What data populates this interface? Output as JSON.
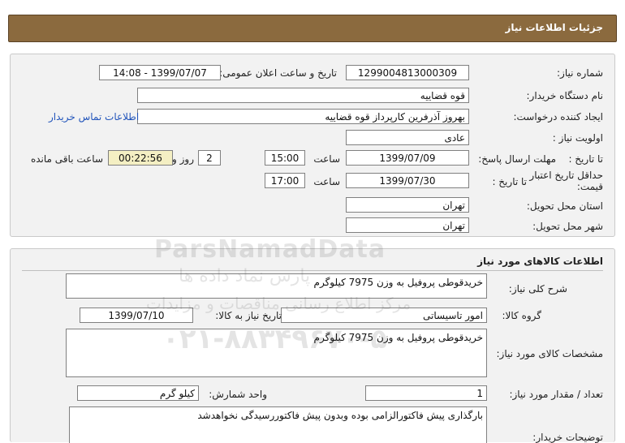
{
  "header": {
    "title": "جزئیات اطلاعات نیاز"
  },
  "info": {
    "need_number_label": "شماره نیاز:",
    "need_number": "1299004813000309",
    "announce_label": "تاریخ و ساعت اعلان عمومی:",
    "announce_value": "1399/07/07 - 14:08",
    "buyer_label": "نام دستگاه خریدار:",
    "buyer_value": "قوه قضاییه",
    "creator_label": "ایجاد کننده درخواست:",
    "creator_value": "بهروز آذرفرین کارپرداز قوه قضاییه",
    "contact_link": "اطلاعات تماس خریدار",
    "priority_label": "اولویت نیاز :",
    "priority_value": "عادی",
    "deadline_label": "مهلت ارسال پاسخ:",
    "to_date_label": "تا تاریخ :",
    "deadline_date": "1399/07/09",
    "time_label": "ساعت",
    "deadline_time": "15:00",
    "days_value": "2",
    "days_label": "روز و",
    "remaining_time": "00:22:56",
    "remaining_label": "ساعت باقی مانده",
    "validity_label": "حداقل تاریخ اعتبار قیمت:",
    "validity_to_label": "تا تاریخ :",
    "validity_date": "1399/07/30",
    "validity_time_label": "ساعت",
    "validity_time": "17:00",
    "province_label": "استان محل تحویل:",
    "province_value": "تهران",
    "city_label": "شهر محل تحویل:",
    "city_value": "تهران"
  },
  "goods": {
    "section_title": "اطلاعات کالاهای مورد نیاز",
    "desc_label": "شرح کلی نیاز:",
    "desc_value": "خریدقوطی پروفیل به وزن 7975 کیلوگرم",
    "group_label": "گروه کالا:",
    "group_value": "امور تاسیساتی",
    "need_date_label": "تاریخ نیاز به کالا:",
    "need_date_value": "1399/07/10",
    "spec_label": "مشخصات کالای مورد نیاز:",
    "spec_value": "خریدقوطی پروفیل به وزن 7975 کیلوگرم",
    "qty_label": "تعداد / مقدار مورد نیاز:",
    "qty_value": "1",
    "unit_label": "واحد شمارش:",
    "unit_value": "کیلو گرم",
    "buyer_notes_label": "توضیحات خریدار:",
    "buyer_notes_value": "بارگذاری پیش فاکتورالزامی بوده وبدون پیش فاکتوررسیدگی نخواهدشد"
  },
  "watermark": {
    "line1": "ParsNamadData",
    "line2": "پارس نماد داده ها",
    "line3": "مرکز اطلاع رسانی مناقصات و مزایدات",
    "line4": "۰۲۱-۸۸۳۴۹۶۷۰-۵"
  }
}
